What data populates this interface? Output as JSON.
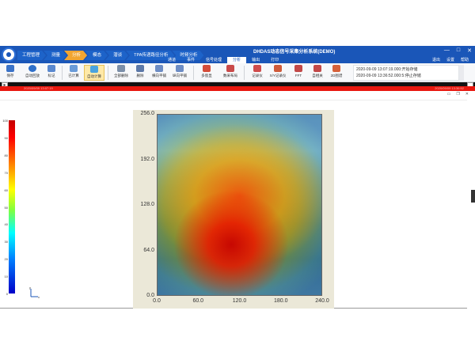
{
  "titlebar": {
    "app_title": "DHDAS动态信号采集分析系统(DEMO)",
    "crumbs": [
      {
        "label": "工程管理",
        "active": false
      },
      {
        "label": "测量",
        "active": false
      },
      {
        "label": "分析",
        "active": true
      },
      {
        "label": "模态",
        "active": false
      },
      {
        "label": "潜谈",
        "active": false
      },
      {
        "label": "TPA传递路径分析",
        "active": false
      },
      {
        "label": "时频分析",
        "active": false
      }
    ],
    "menu_tabs": [
      {
        "label": "通道",
        "active": false
      },
      {
        "label": "事件",
        "active": false
      },
      {
        "label": "信号处理",
        "active": false
      },
      {
        "label": "分析",
        "active": true
      },
      {
        "label": "输出",
        "active": false
      },
      {
        "label": "打印",
        "active": false
      }
    ],
    "user": [
      "退出",
      "设置",
      "帮助"
    ],
    "window_controls": [
      "—",
      "□",
      "✕"
    ]
  },
  "ribbon": {
    "buttons": [
      {
        "label": "保存",
        "icon": "save-icon",
        "color": "#3b73c8"
      },
      {
        "label": "自动回放",
        "icon": "play-icon",
        "color": "#2e6fc9"
      },
      {
        "label": "标记",
        "icon": "marker-icon",
        "color": "#5a88cf"
      },
      {
        "label": "已计算",
        "icon": "calc-icon",
        "color": "#6a9bd8"
      },
      {
        "label": "自动计算",
        "icon": "auto-calc-icon",
        "color": "#4aa3df",
        "selected": true
      },
      {
        "label": "全部删除",
        "icon": "delete-all-icon",
        "color": "#7b8ea8"
      },
      {
        "label": "删除",
        "icon": "delete-icon",
        "color": "#5c78a8"
      },
      {
        "label": "横向平铺",
        "icon": "tile-horizontal-icon",
        "color": "#6d8cc4"
      },
      {
        "label": "纵向平铺",
        "icon": "tile-vertical-icon",
        "color": "#6d8cc4"
      },
      {
        "label": "多窗显",
        "icon": "multi-window-icon",
        "color": "#d44d3a"
      },
      {
        "label": "数采布局",
        "icon": "layout-icon",
        "color": "#c94a4a"
      },
      {
        "label": "记录仪",
        "icon": "recorder-icon",
        "color": "#d04c4c"
      },
      {
        "label": "X/Y记录仪",
        "icon": "xy-recorder-icon",
        "color": "#cf5a3a"
      },
      {
        "label": "FFT",
        "icon": "fft-icon",
        "color": "#c24848"
      },
      {
        "label": "自相关",
        "icon": "autocorr-icon",
        "color": "#c24848"
      },
      {
        "label": "2D图谱",
        "icon": "heatmap-2d-icon",
        "color": "#d6613a"
      }
    ],
    "log": [
      "2020-09-09 13:07:19.000:开始存储",
      "2020-09-09 13:36:52.000:5:停止存储"
    ]
  },
  "status": {
    "timestamp_left": "2020/09/09 13:07:19",
    "timestamp_right": "2020/09/09 13:36:52"
  },
  "chart_data": {
    "type": "heatmap",
    "title": "",
    "xlabel": "",
    "ylabel": "",
    "x_ticks": [
      "0.0",
      "60.0",
      "120.0",
      "180.0",
      "240.0"
    ],
    "y_ticks": [
      "256.0",
      "192.0",
      "128.0",
      "64.0",
      "0.0"
    ],
    "xlim": [
      0,
      240
    ],
    "ylim": [
      0,
      256
    ],
    "colorbar": {
      "min": 0,
      "max": 100,
      "ticks": [
        "100",
        "90",
        "80",
        "70",
        "60",
        "50",
        "40",
        "30",
        "20",
        "10",
        "0"
      ]
    },
    "background": "photo of equipment overlaid with acoustic heat map",
    "hotspot_center": {
      "x": 95,
      "y": 70
    }
  },
  "mini_axes": {
    "y": "y",
    "x": "x"
  }
}
